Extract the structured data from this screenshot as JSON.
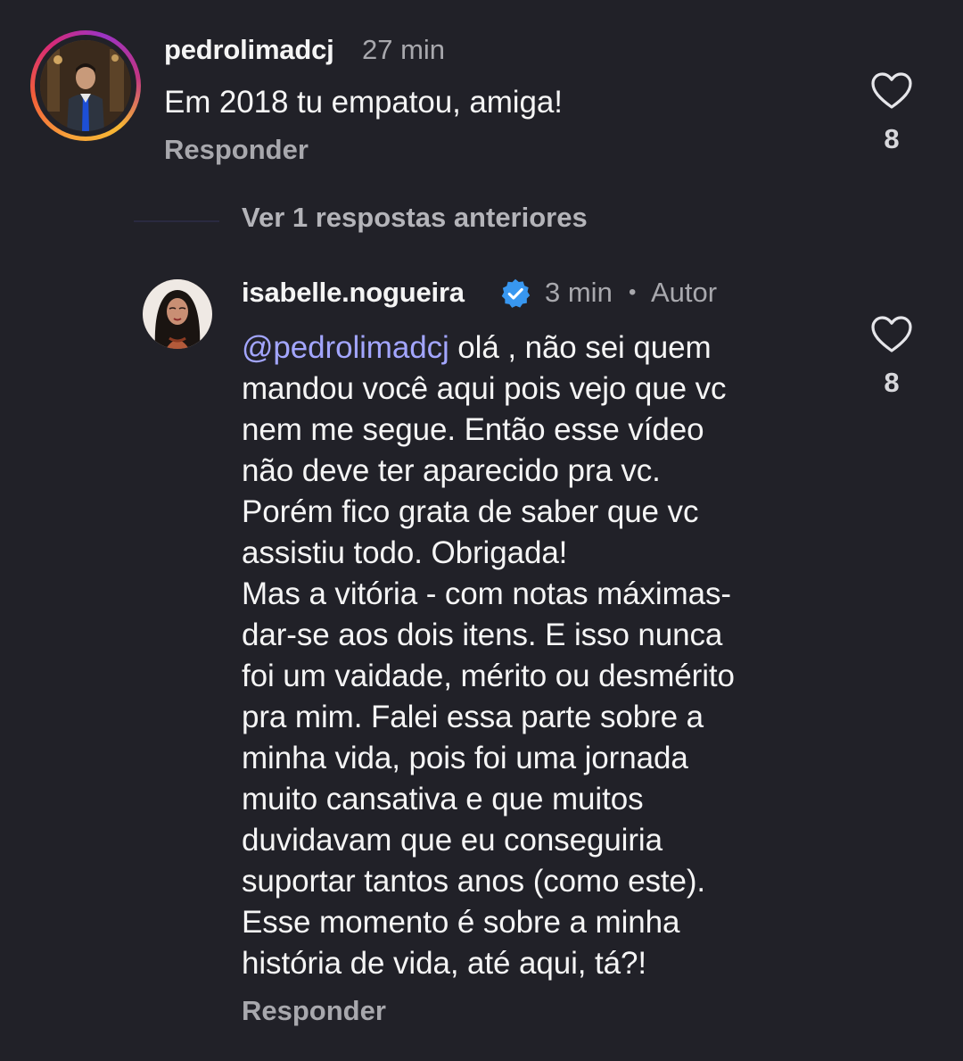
{
  "colors": {
    "background": "#212128",
    "text_primary": "#f5f5f5",
    "text_secondary": "#a8a8ad",
    "mention": "#a3a6ff",
    "verified_badge": "#3897f0"
  },
  "comments": [
    {
      "username": "pedrolimadcj",
      "time": "27 min",
      "text": "Em 2018 tu empatou, amiga!",
      "reply_label": "Responder",
      "likes": "8",
      "like_icon": "heart-outline-icon",
      "avatar": "profile-photo-man-in-suit"
    }
  ],
  "view_replies": "Ver 1 respostas anteriores",
  "reply": {
    "username": "isabelle.nogueira",
    "verified_icon": "verified-badge-icon",
    "time": "3 min",
    "separator": "•",
    "author_tag": "Autor",
    "mention": "@pedrolimadcj",
    "text_after_mention": " olá , não sei quem\nmandou você aqui pois vejo que vc\nnem me segue. Então esse vídeo\nnão deve ter aparecido pra vc.\nPorém fico grata de saber que vc\nassistiu todo. Obrigada!\nMas a vitória - com notas máximas-\ndar-se aos dois itens. E isso nunca\nfoi um vaidade, mérito ou desmérito\npra mim. Falei essa parte sobre a\nminha vida, pois foi uma jornada\nmuito cansativa e que muitos\nduvidavam que eu conseguiria\nsuportar tantos anos (como este).\nEsse momento é sobre a minha\nhistória de vida, até aqui, tá?!",
    "reply_label": "Responder",
    "likes": "8",
    "like_icon": "heart-outline-icon",
    "avatar": "profile-photo-woman"
  }
}
